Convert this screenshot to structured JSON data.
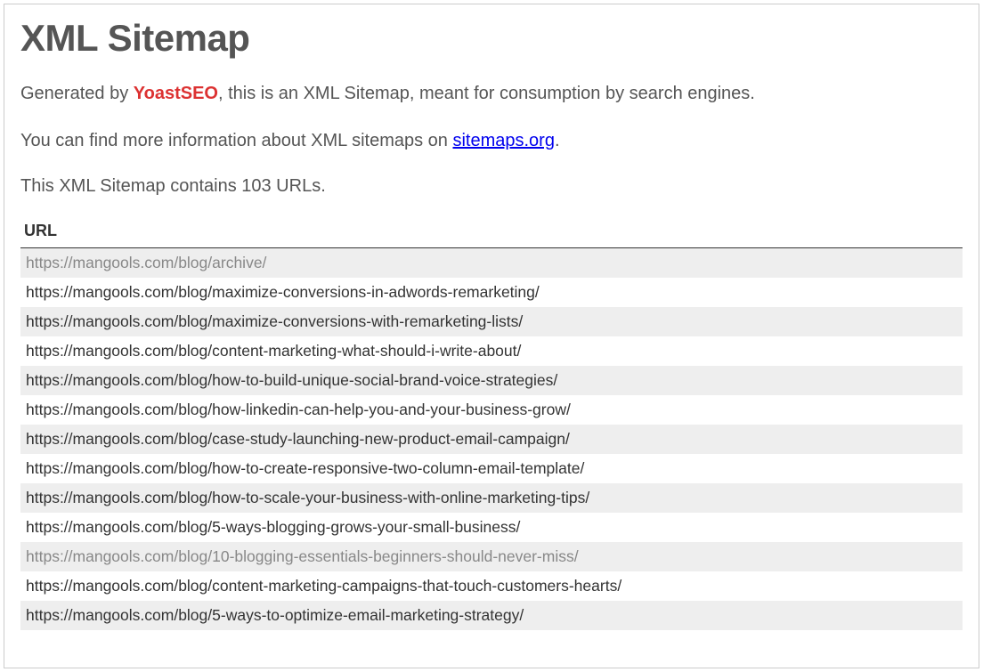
{
  "heading": "XML Sitemap",
  "intro": {
    "prefix": "Generated by ",
    "yoast_text": "YoastSEO",
    "middle": ", this is an XML Sitemap, meant for consumption by search engines."
  },
  "info": {
    "prefix": "You can find more information about XML sitemaps on ",
    "link_text": "sitemaps.org",
    "suffix": "."
  },
  "count_line": "This XML Sitemap contains 103 URLs.",
  "table": {
    "header": "URL",
    "urls": [
      {
        "url": "https://mangools.com/blog/archive/",
        "greyed": true
      },
      {
        "url": "https://mangools.com/blog/maximize-conversions-in-adwords-remarketing/",
        "greyed": false
      },
      {
        "url": "https://mangools.com/blog/maximize-conversions-with-remarketing-lists/",
        "greyed": false
      },
      {
        "url": "https://mangools.com/blog/content-marketing-what-should-i-write-about/",
        "greyed": false
      },
      {
        "url": "https://mangools.com/blog/how-to-build-unique-social-brand-voice-strategies/",
        "greyed": false
      },
      {
        "url": "https://mangools.com/blog/how-linkedin-can-help-you-and-your-business-grow/",
        "greyed": false
      },
      {
        "url": "https://mangools.com/blog/case-study-launching-new-product-email-campaign/",
        "greyed": false
      },
      {
        "url": "https://mangools.com/blog/how-to-create-responsive-two-column-email-template/",
        "greyed": false
      },
      {
        "url": "https://mangools.com/blog/how-to-scale-your-business-with-online-marketing-tips/",
        "greyed": false
      },
      {
        "url": "https://mangools.com/blog/5-ways-blogging-grows-your-small-business/",
        "greyed": false
      },
      {
        "url": "https://mangools.com/blog/10-blogging-essentials-beginners-should-never-miss/",
        "greyed": true
      },
      {
        "url": "https://mangools.com/blog/content-marketing-campaigns-that-touch-customers-hearts/",
        "greyed": false
      },
      {
        "url": "https://mangools.com/blog/5-ways-to-optimize-email-marketing-strategy/",
        "greyed": false
      }
    ]
  }
}
